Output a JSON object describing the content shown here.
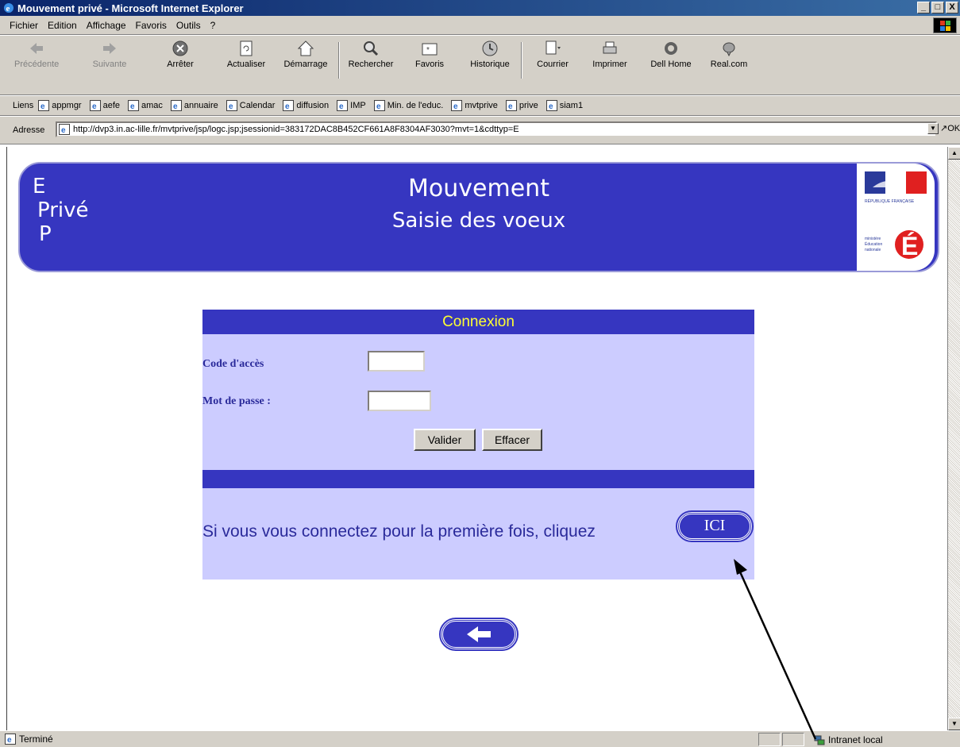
{
  "window": {
    "title": "Mouvement privé - Microsoft Internet Explorer",
    "min_label": "_",
    "max_label": "□",
    "close_label": "X"
  },
  "menu": {
    "items": [
      "Fichier",
      "Edition",
      "Affichage",
      "Favoris",
      "Outils",
      "?"
    ]
  },
  "toolbar": {
    "buttons": [
      {
        "label": "Précédente",
        "icon": "back-arrow-icon",
        "enabled": false
      },
      {
        "label": "Suivante",
        "icon": "forward-arrow-icon",
        "enabled": false
      },
      {
        "label": "Arrêter",
        "icon": "stop-icon",
        "enabled": true
      },
      {
        "label": "Actualiser",
        "icon": "refresh-icon",
        "enabled": true
      },
      {
        "label": "Démarrage",
        "icon": "home-icon",
        "enabled": true
      },
      {
        "label": "Rechercher",
        "icon": "search-icon",
        "enabled": true
      },
      {
        "label": "Favoris",
        "icon": "favorites-icon",
        "enabled": true
      },
      {
        "label": "Historique",
        "icon": "history-icon",
        "enabled": true
      },
      {
        "label": "Courrier",
        "icon": "mail-icon",
        "enabled": true
      },
      {
        "label": "Imprimer",
        "icon": "print-icon",
        "enabled": true
      },
      {
        "label": "Dell Home",
        "icon": "dell-icon",
        "enabled": true
      },
      {
        "label": "Real.com",
        "icon": "real-icon",
        "enabled": true
      }
    ]
  },
  "links": {
    "label": "Liens",
    "items": [
      "appmgr",
      "aefe",
      "amac",
      "annuaire",
      "Calendar",
      "diffusion",
      "IMP",
      "Min. de l'educ.",
      "mvtprive",
      "prive",
      "siam1"
    ]
  },
  "address": {
    "label": "Adresse",
    "url": "http://dvp3.in.ac-lille.fr/mvtprive/jsp/logc.jsp;jsessionid=383172DAC8B452CF661A8F8304AF3030?mvt=1&cdttyp=E",
    "go_label": "OK"
  },
  "banner": {
    "epp_line1": "E",
    "epp_line2": "Privé",
    "epp_line3": "P",
    "title": "Mouvement",
    "subtitle": "Saisie des voeux",
    "logo_text_top": "RÉPUBLIQUE FRANÇAISE",
    "logo_text_side": "ministère Éducation nationale"
  },
  "form": {
    "heading": "Connexion",
    "code_label": "Code d'accès",
    "code_value": "",
    "password_label": "Mot de passe :",
    "password_value": "",
    "submit_label": "Valider",
    "reset_label": "Effacer",
    "first_time_text": "Si vous vous connectez pour la première fois, cliquez",
    "ici_label": "ICI"
  },
  "status": {
    "text": "Terminé",
    "zone": "Intranet local"
  },
  "colors": {
    "brand_blue": "#3636c0",
    "form_bg": "#ccccff",
    "heading_yellow": "#ffff33",
    "label_blue": "#2a2a9a"
  }
}
